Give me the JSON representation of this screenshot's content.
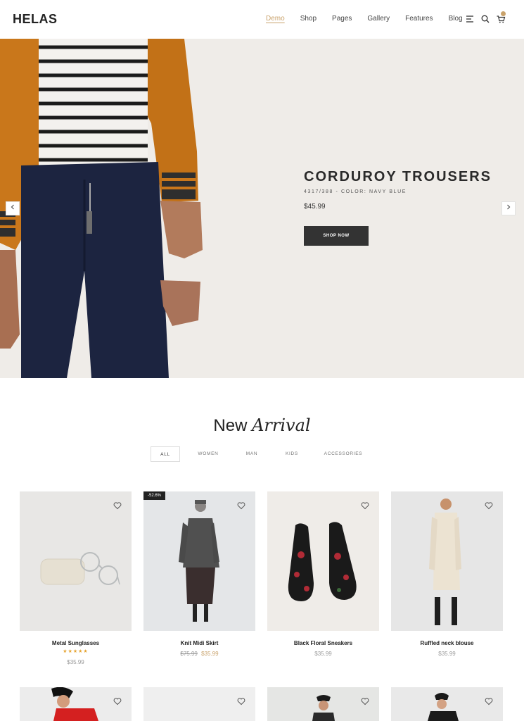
{
  "header": {
    "logo": "HELAS",
    "nav": [
      "Demo",
      "Shop",
      "Pages",
      "Gallery",
      "Features",
      "Blog"
    ],
    "active_nav": "Demo",
    "icons": [
      "menu-icon",
      "search-icon",
      "cart-icon"
    ]
  },
  "hero": {
    "title": "CORDUROY TROUSERS",
    "sku": "4317/388 - COLOR: NAVY BLUE",
    "price": "$45.99",
    "button": "SHOP NOW"
  },
  "section": {
    "title_a": "New",
    "title_b": "Arrival",
    "filters": [
      "ALL",
      "WOMEN",
      "MAN",
      "KIDS",
      "ACCESSORIES"
    ],
    "active_filter": "ALL"
  },
  "products": [
    {
      "name": "Metal Sunglasses",
      "price": "$35.99",
      "rating": 5
    },
    {
      "name": "Knit Midi Skirt",
      "old_price": "$75.99",
      "price": "$35.99",
      "badge": "-52.6%"
    },
    {
      "name": "Black Floral Sneakers",
      "price": "$35.99"
    },
    {
      "name": "Ruffled neck blouse",
      "price": "$35.99"
    }
  ],
  "colors": {
    "accent": "#c9a26b",
    "hero_bg": "#efece8",
    "button": "#333333",
    "star": "#e5a431"
  }
}
